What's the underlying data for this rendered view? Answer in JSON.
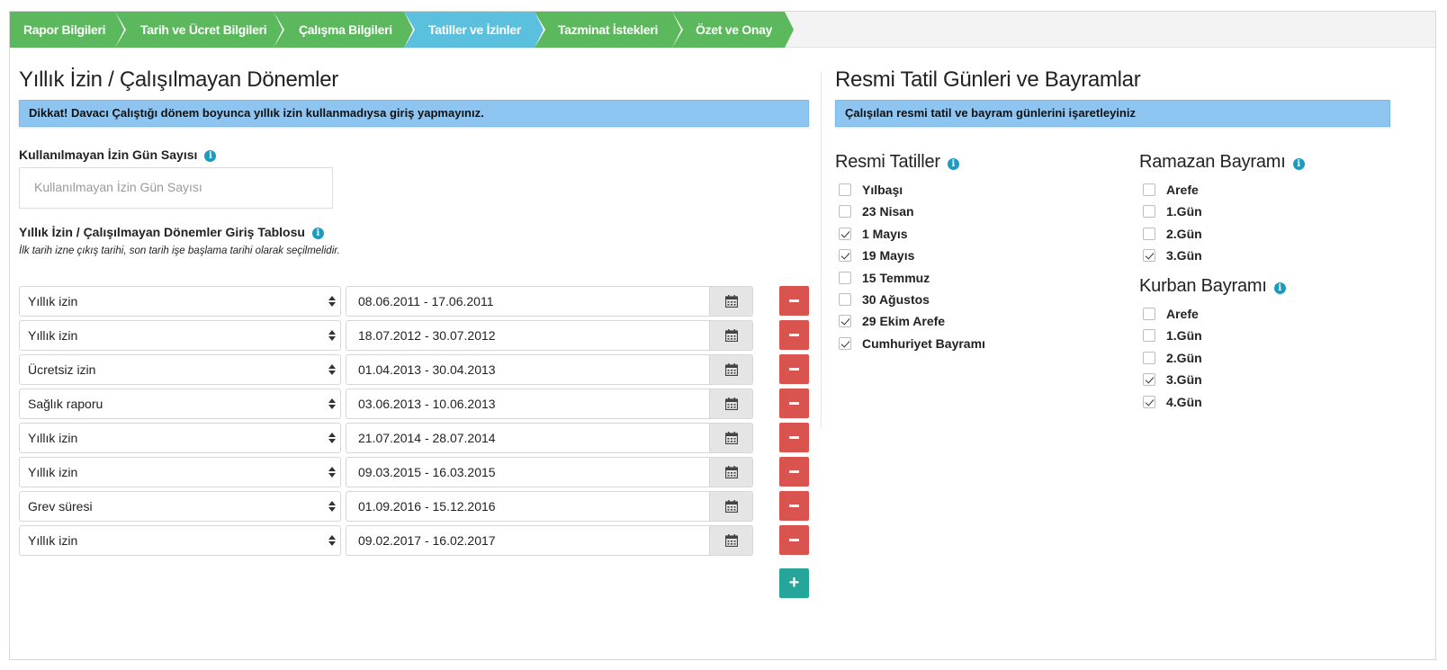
{
  "steps": [
    {
      "label": "Rapor Bilgileri",
      "state": "done"
    },
    {
      "label": "Tarih ve Ücret Bilgileri",
      "state": "done"
    },
    {
      "label": "Çalışma Bilgileri",
      "state": "done"
    },
    {
      "label": "Tatiller ve İzinler",
      "state": "active"
    },
    {
      "label": "Tazminat İstekleri",
      "state": "done"
    },
    {
      "label": "Özet ve Onay",
      "state": "done"
    }
  ],
  "left": {
    "title": "Yıllık İzin / Çalışılmayan Dönemler",
    "alert": "Dikkat! Davacı Çalıştığı dönem boyunca yıllık izin kullanmadıysa giriş yapmayınız.",
    "unused_label": "Kullanılmayan İzin Gün Sayısı",
    "unused_placeholder": "Kullanılmayan İzin Gün Sayısı",
    "table_label": "Yıllık İzin / Çalışılmayan Dönemler Giriş Tablosu",
    "table_hint": "İlk tarih izne çıkış tarihi, son tarih işe başlama tarihi olarak seçilmelidir.",
    "rows": [
      {
        "type": "Yıllık izin",
        "range": "08.06.2011 - 17.06.2011"
      },
      {
        "type": "Yıllık izin",
        "range": "18.07.2012 - 30.07.2012"
      },
      {
        "type": "Ücretsiz izin",
        "range": "01.04.2013 - 30.04.2013"
      },
      {
        "type": "Sağlık raporu",
        "range": "03.06.2013 - 10.06.2013"
      },
      {
        "type": "Yıllık izin",
        "range": "21.07.2014 - 28.07.2014"
      },
      {
        "type": "Yıllık izin",
        "range": "09.03.2015 - 16.03.2015"
      },
      {
        "type": "Grev süresi",
        "range": "01.09.2016 - 15.12.2016"
      },
      {
        "type": "Yıllık izin",
        "range": "09.02.2017 - 16.02.2017"
      }
    ],
    "add_label": "+"
  },
  "right": {
    "title": "Resmi Tatil Günleri ve Bayramlar",
    "alert": "Çalışılan resmi tatil ve bayram günlerini işaretleyiniz",
    "official": {
      "title": "Resmi Tatiller",
      "items": [
        {
          "label": "Yılbaşı",
          "checked": false
        },
        {
          "label": "23 Nisan",
          "checked": false
        },
        {
          "label": "1 Mayıs",
          "checked": true
        },
        {
          "label": "19 Mayıs",
          "checked": true
        },
        {
          "label": "15 Temmuz",
          "checked": false
        },
        {
          "label": "30 Ağustos",
          "checked": false
        },
        {
          "label": "29 Ekim Arefe",
          "checked": true
        },
        {
          "label": "Cumhuriyet Bayramı",
          "checked": true
        }
      ]
    },
    "ramazan": {
      "title": "Ramazan Bayramı",
      "items": [
        {
          "label": "Arefe",
          "checked": false
        },
        {
          "label": "1.Gün",
          "checked": false
        },
        {
          "label": "2.Gün",
          "checked": false
        },
        {
          "label": "3.Gün",
          "checked": true
        }
      ]
    },
    "kurban": {
      "title": "Kurban Bayramı",
      "items": [
        {
          "label": "Arefe",
          "checked": false
        },
        {
          "label": "1.Gün",
          "checked": false
        },
        {
          "label": "2.Gün",
          "checked": false
        },
        {
          "label": "3.Gün",
          "checked": true
        },
        {
          "label": "4.Gün",
          "checked": true
        }
      ]
    }
  },
  "colors": {
    "step_done": "#5cb85c",
    "step_active": "#5bc0de",
    "alert_bg": "#8ec5f0",
    "delete_button": "#d9534f",
    "add_button": "#26a69a",
    "info_icon": "#1a9bbf"
  }
}
